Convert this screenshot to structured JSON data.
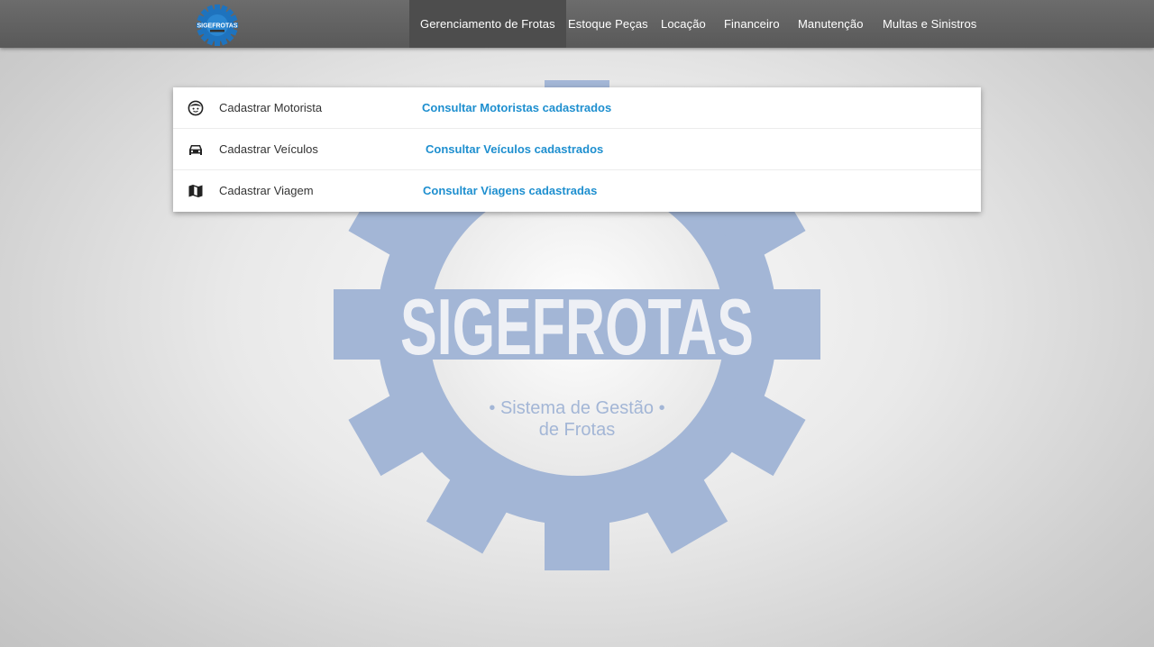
{
  "brand": {
    "logo_text": "SIGEFROTAS",
    "logo_color": "#1e73be"
  },
  "nav": {
    "items": [
      {
        "label": "Gerenciamento de Frotas",
        "active": true
      },
      {
        "label": "Estoque Peças"
      },
      {
        "label": "Locação"
      },
      {
        "label": "Financeiro"
      },
      {
        "label": "Manutenção"
      },
      {
        "label": "Multas e Sinistros"
      }
    ]
  },
  "menu": {
    "rows": [
      {
        "icon": "face-icon",
        "label": "Cadastrar Motorista",
        "link": "Consultar Motoristas cadastrados"
      },
      {
        "icon": "car-icon",
        "label": "Cadastrar Veículos",
        "link": "Consultar Veículos cadastrados"
      },
      {
        "icon": "map-icon",
        "label": "Cadastrar Viagem",
        "link": "Consultar Viagens cadastradas"
      }
    ]
  },
  "watermark": {
    "title": "SIGEFROTAS",
    "subtitle_line1": "• Sistema de Gestão •",
    "subtitle_line2": "de Frotas"
  },
  "colors": {
    "navbar": "#595959",
    "nav_active": "#4d4d4d",
    "link": "#1e8fcf",
    "watermark_gear": "#a3b6d6"
  }
}
